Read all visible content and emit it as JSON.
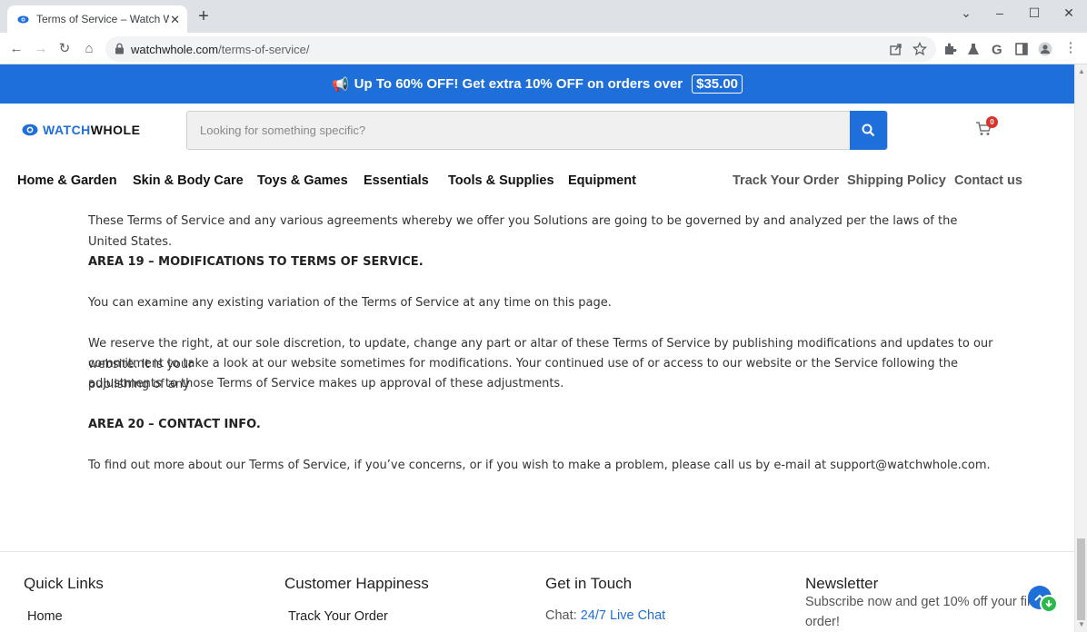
{
  "browser": {
    "tab_title": "Terms of Service – Watch Whole",
    "url_host": "watchwhole.com",
    "url_path": "/terms-of-service/"
  },
  "promo": {
    "text": "Up To 60% OFF! Get extra 10% OFF on orders over",
    "amount": "$35.00"
  },
  "header": {
    "logo_part1": "WATCH",
    "logo_part2": "WHOLE",
    "search_placeholder": "Looking for something specific?",
    "cart_count": "0"
  },
  "nav": {
    "items": [
      "Home & Garden",
      "Skin & Body Care",
      "Toys & Games",
      "Essentials",
      "Tools & Supplies",
      "Equipment"
    ],
    "right_items": [
      "Track Your Order",
      "Shipping Policy",
      "Contact us"
    ]
  },
  "content": {
    "p1": "These Terms of Service and any various agreements whereby we offer you Solutions are going to be governed by and analyzed per the laws of the United States.",
    "h19": "AREA 19 – MODIFICATIONS TO TERMS OF SERVICE.",
    "p2": "You can examine any existing variation of the Terms of Service at any time on this page.",
    "p3a": "We reserve the right, at our sole discretion, to update, change any part or altar of these Terms of Service by publishing modifications and updates to our website. It is your",
    "p3b": "commitment to take a look at our website sometimes for modifications. Your continued use of or access to our website or the Service following the publishing of any",
    "p3c": "adjustments to those Terms of Service makes up approval of these adjustments.",
    "h20": "AREA 20 – CONTACT INFO.",
    "p4": "To find out more about our Terms of Service, if you’ve concerns, or if you wish to make a problem, please call us by e-mail at support@watchwhole.com."
  },
  "footer": {
    "quick_links": {
      "heading": "Quick Links",
      "first": "Home"
    },
    "customer": {
      "heading": "Customer Happiness",
      "first": "Track Your Order"
    },
    "contact": {
      "heading": "Get in Touch",
      "chat_label": "Chat:",
      "chat_link": "24/7 Live Chat"
    },
    "newsletter": {
      "heading": "Newsletter",
      "line1": "Subscribe now and get 10% off your first",
      "line2": "order!"
    }
  },
  "colors": {
    "brand": "#1e6fd9",
    "badge": "#d9342b",
    "green": "#2db84b"
  }
}
